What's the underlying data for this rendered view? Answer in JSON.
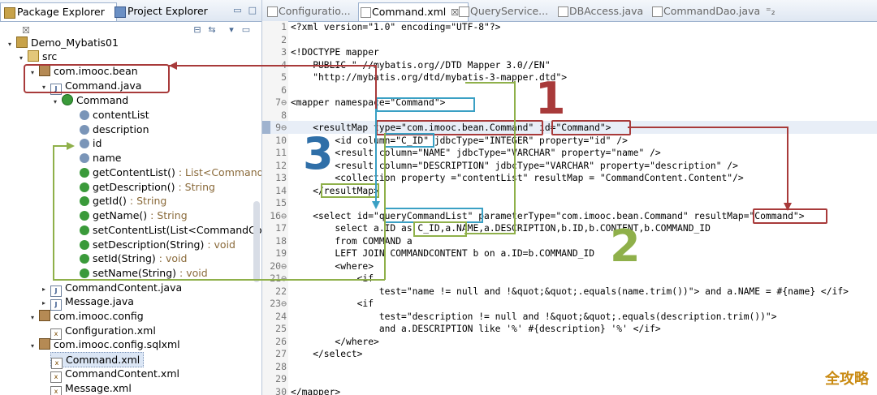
{
  "left_panel": {
    "tabs": [
      {
        "label": "Package Explorer",
        "close": "☒"
      },
      {
        "label": "Project Explorer"
      }
    ],
    "tree": [
      {
        "label": "Demo_Mybatis01",
        "kind": "project",
        "twisty": "▾"
      },
      {
        "label": "src",
        "kind": "src",
        "twisty": "▾"
      },
      {
        "label": "com.imooc.bean",
        "kind": "package",
        "twisty": "▾"
      },
      {
        "label": "Command.java",
        "kind": "java",
        "twisty": "▾"
      },
      {
        "label": "Command",
        "kind": "class",
        "twisty": "▾"
      },
      {
        "label": "contentList",
        "kind": "field"
      },
      {
        "label": "description",
        "kind": "field"
      },
      {
        "label": "id",
        "kind": "field"
      },
      {
        "label": "name",
        "kind": "field"
      },
      {
        "label": "getContentList()",
        "suffix": " : List<Command",
        "kind": "method"
      },
      {
        "label": "getDescription()",
        "suffix": " : String",
        "kind": "method"
      },
      {
        "label": "getId()",
        "suffix": " : String",
        "kind": "method"
      },
      {
        "label": "getName()",
        "suffix": " : String",
        "kind": "method"
      },
      {
        "label": "setContentList(List<CommandCo",
        "suffix": "",
        "kind": "method"
      },
      {
        "label": "setDescription(String)",
        "suffix": " : void",
        "kind": "method"
      },
      {
        "label": "setId(String)",
        "suffix": " : void",
        "kind": "method"
      },
      {
        "label": "setName(String)",
        "suffix": " : void",
        "kind": "method"
      },
      {
        "label": "CommandContent.java",
        "kind": "java",
        "twisty": "▸"
      },
      {
        "label": "Message.java",
        "kind": "java",
        "twisty": "▸"
      },
      {
        "label": "com.imooc.config",
        "kind": "package",
        "twisty": "▾"
      },
      {
        "label": "Configuration.xml",
        "kind": "xml"
      },
      {
        "label": "com.imooc.config.sqlxml",
        "kind": "package",
        "twisty": "▾"
      },
      {
        "label": "Command.xml",
        "kind": "xml",
        "selected": true
      },
      {
        "label": "CommandContent.xml",
        "kind": "xml"
      },
      {
        "label": "Message.xml",
        "kind": "xml"
      }
    ]
  },
  "editor": {
    "tabs": [
      {
        "label": "Configuratio..."
      },
      {
        "label": "Command.xml",
        "active": true,
        "close": "☒"
      },
      {
        "label": "QueryService..."
      },
      {
        "label": "DBAccess.java"
      },
      {
        "label": "CommandDao.java"
      },
      {
        "label": "⁼₂"
      }
    ],
    "lines": [
      {
        "n": "1",
        "t": "<?xml version=\"1.0\" encoding=\"UTF-8\"?>"
      },
      {
        "n": "2",
        "t": ""
      },
      {
        "n": "3",
        "t": "<!DOCTYPE mapper"
      },
      {
        "n": "4",
        "t": "    PUBLIC \"-//mybatis.org//DTD Mapper 3.0//EN\""
      },
      {
        "n": "5",
        "t": "    \"http://mybatis.org/dtd/mybatis-3-mapper.dtd\">"
      },
      {
        "n": "6",
        "t": ""
      },
      {
        "n": "7⊖",
        "t": "<mapper namespace=\"Command\">"
      },
      {
        "n": "8",
        "t": ""
      },
      {
        "n": "9⊖",
        "t": "    <resultMap type=\"com.imooc.bean.Command\" id=\"Command\">"
      },
      {
        "n": "10",
        "t": "        <id column=\"C_ID\" jdbcType=\"INTEGER\" property=\"id\" />"
      },
      {
        "n": "11",
        "t": "        <result column=\"NAME\" jdbcType=\"VARCHAR\" property=\"name\" />"
      },
      {
        "n": "12",
        "t": "        <result column=\"DESCRIPTION\" jdbcType=\"VARCHAR\" property=\"description\" />"
      },
      {
        "n": "13",
        "t": "        <collection property =\"contentList\" resultMap = \"CommandContent.Content\"/>"
      },
      {
        "n": "14",
        "t": "    </resultMap>"
      },
      {
        "n": "15",
        "t": ""
      },
      {
        "n": "16⊖",
        "t": "    <select id=\"queryCommandList\" parameterType=\"com.imooc.bean.Command\" resultMap=\"Command\">"
      },
      {
        "n": "17",
        "t": "        select a.ID as C_ID,a.NAME,a.DESCRIPTION,b.ID,b.CONTENT,b.COMMAND_ID"
      },
      {
        "n": "18",
        "t": "        from COMMAND a"
      },
      {
        "n": "19",
        "t": "        LEFT JOIN COMMANDCONTENT b on a.ID=b.COMMAND_ID"
      },
      {
        "n": "20⊖",
        "t": "        <where>"
      },
      {
        "n": "21⊖",
        "t": "            <if"
      },
      {
        "n": "22",
        "t": "                test=\"name != null and !&quot;&quot;.equals(name.trim())\"> and a.NAME = #{name} </if>"
      },
      {
        "n": "23⊖",
        "t": "            <if"
      },
      {
        "n": "24",
        "t": "                test=\"description != null and !&quot;&quot;.equals(description.trim())\">"
      },
      {
        "n": "25",
        "t": "                and a.DESCRIPTION like '%' #{description} '%' </if>"
      },
      {
        "n": "26",
        "t": "        </where>"
      },
      {
        "n": "27",
        "t": "    </select>"
      },
      {
        "n": "28",
        "t": ""
      },
      {
        "n": "29",
        "t": ""
      },
      {
        "n": "30",
        "t": "</mapper>"
      }
    ]
  },
  "annotations": {
    "num1": "1",
    "num2": "2",
    "num3": "3",
    "color_red": "#a83a3a",
    "color_blue": "#3aa0c4",
    "color_green": "#8fb04a"
  },
  "watermark": "全攻略"
}
